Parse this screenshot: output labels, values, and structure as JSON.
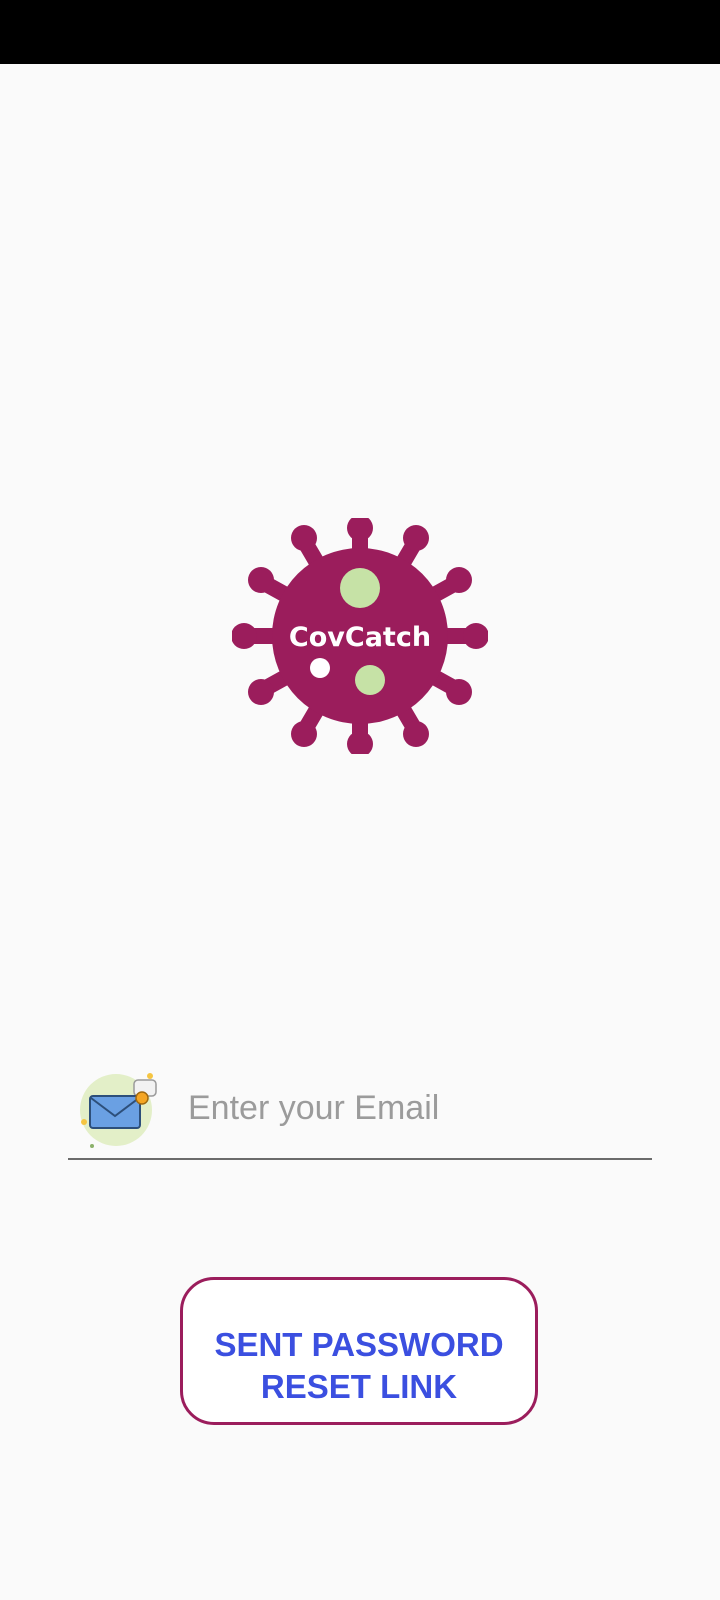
{
  "colors": {
    "status_bar": "#000000",
    "background": "#fafafa",
    "logo_primary": "#9b1d5c",
    "logo_spots": "#c6e2a6",
    "button_border": "#9b1d5c",
    "button_text": "#3b4fe0"
  },
  "logo": {
    "text": "CovCatch",
    "icon": "virus-icon"
  },
  "email_field": {
    "icon": "email-envelope-icon",
    "placeholder": "Enter your Email",
    "value": ""
  },
  "reset_button": {
    "label_line1": "SENT PASSWORD",
    "label_line2": "RESET LINK"
  }
}
